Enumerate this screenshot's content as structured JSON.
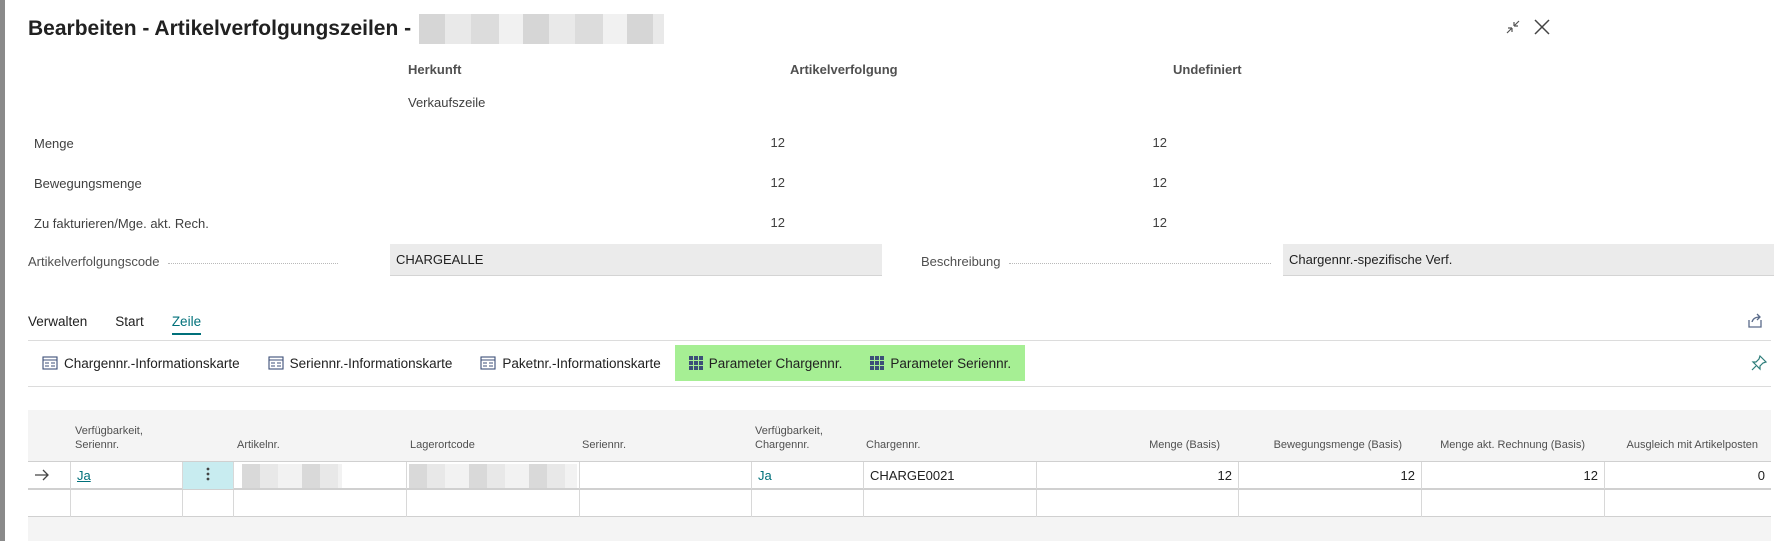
{
  "window": {
    "title": "Bearbeiten - Artikelverfolgungszeilen -"
  },
  "summary": {
    "headers": {
      "herkunft": "Herkunft",
      "artikelverfolgung": "Artikelverfolgung",
      "undefiniert": "Undefiniert"
    },
    "herkunft_sub": "Verkaufszeile",
    "rows": [
      {
        "label": "Menge",
        "artikelverfolgung": "12",
        "undefiniert": "12"
      },
      {
        "label": "Bewegungsmenge",
        "artikelverfolgung": "12",
        "undefiniert": "12"
      },
      {
        "label": "Zu fakturieren/Mge. akt. Rech.",
        "artikelverfolgung": "12",
        "undefiniert": "12"
      }
    ]
  },
  "fields": {
    "artikelverfolgungscode": {
      "label": "Artikelverfolgungscode",
      "value": "CHARGEALLE"
    },
    "beschreibung": {
      "label": "Beschreibung",
      "value": "Chargennr.-spezifische Verf."
    }
  },
  "tabs": [
    {
      "label": "Verwalten",
      "active": false
    },
    {
      "label": "Start",
      "active": false
    },
    {
      "label": "Zeile",
      "active": true
    }
  ],
  "actions": [
    {
      "label": "Chargennr.-Informationskarte",
      "icon": "card-icon",
      "highlighted": false
    },
    {
      "label": "Seriennr.-Informationskarte",
      "icon": "card-icon",
      "highlighted": false
    },
    {
      "label": "Paketnr.-Informationskarte",
      "icon": "card-icon",
      "highlighted": false
    },
    {
      "label": "Parameter Chargennr.",
      "icon": "grid-icon",
      "highlighted": true
    },
    {
      "label": "Parameter Seriennr.",
      "icon": "grid-icon",
      "highlighted": true
    }
  ],
  "grid": {
    "columns": {
      "verfuegbarkeit_serie_1": "Verfügbarkeit,",
      "verfuegbarkeit_serie_2": "Seriennr.",
      "artikelnr": "Artikelnr.",
      "lagerortcode": "Lagerortcode",
      "seriennr": "Seriennr.",
      "verfuegbarkeit_charge_1": "Verfügbarkeit,",
      "verfuegbarkeit_charge_2": "Chargennr.",
      "chargennr": "Chargennr.",
      "menge_basis": "Menge (Basis)",
      "bewegungsmenge_basis": "Bewegungsmenge (Basis)",
      "menge_akt_rechnung_basis": "Menge akt. Rechnung (Basis)",
      "ausgleich": "Ausgleich mit Artikelposten"
    },
    "rows": [
      {
        "verfuegbarkeit_serie": "Ja",
        "verfuegbarkeit_charge": "Ja",
        "chargennr": "CHARGE0021",
        "menge_basis": "12",
        "bewegungsmenge_basis": "12",
        "menge_akt_rechnung_basis": "12",
        "ausgleich": "0"
      }
    ]
  },
  "colors": {
    "accent": "#00707a",
    "highlight": "#a6ef94",
    "selected_cell": "#c8ecf0"
  }
}
